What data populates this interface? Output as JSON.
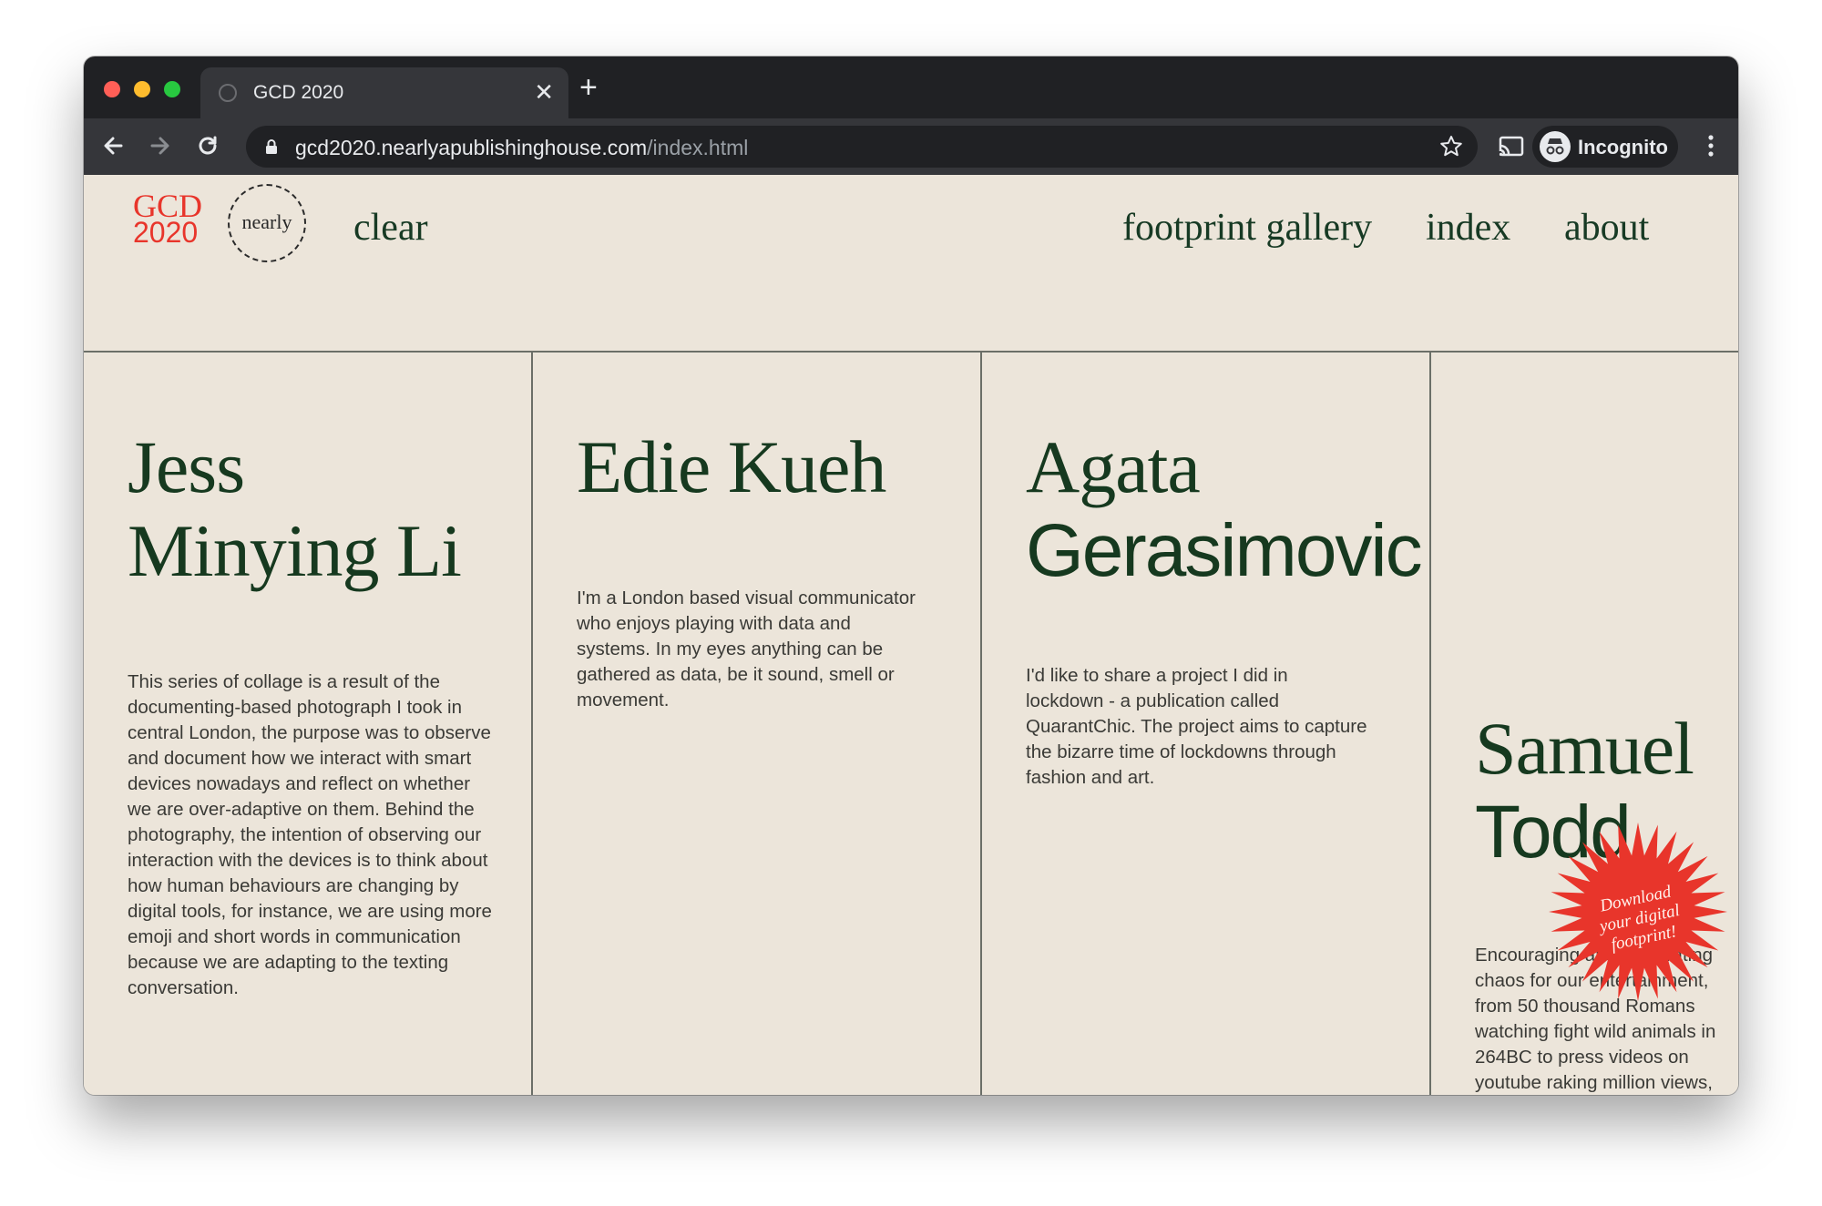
{
  "browser": {
    "tab_title": "GCD 2020",
    "tab_close": "✕",
    "new_tab": "+",
    "url_host": "gcd2020.nearlyapublishinghouse.com",
    "url_path": "/index.html",
    "profile_label": "Incognito"
  },
  "site": {
    "logo_line1": "GCD",
    "logo_line2": "2020",
    "badge_text": "nearly",
    "nav": {
      "clear": "clear",
      "footprint_gallery": "footprint gallery",
      "index": "index",
      "about": "about"
    }
  },
  "contributors": [
    {
      "name_line1": "Jess",
      "name_line2": "Minying Li",
      "bio": "This series of collage is a result of the documenting-based photograph I took in central London, the purpose was to observe and document how we interact with smart devices nowadays and reflect on whether we are over-adaptive on them. Behind the photography, the intention of observing our interaction with the devices is to think about how human behaviours are changing by digital tools, for instance, we are using more emoji and short words in communication because we are adapting to the texting conversation."
    },
    {
      "name_line1": "Edie Kueh",
      "bio": "I'm a London based visual communicator who enjoys playing with data and systems. In my eyes anything can be gathered as data, be it sound, smell or movement."
    },
    {
      "name_line1": "Agata",
      "name_line2": "Gerasimovic",
      "bio": "I'd like to share a project I did in lockdown - a publication called QuarantChic. The project aims to capture the bizarre time of lockdowns through fashion and art."
    },
    {
      "name_line1": "Samuel",
      "name_line2": "Todd",
      "bio": "Encouraging and celebrating chaos for our entertainment, from 50 thousand Romans watching fight wild animals in 264BC to press videos on youtube raking million views, humans have always loved destruction."
    }
  ],
  "starburst": {
    "text": "Download your digital footprint!",
    "color": "#e8352b"
  },
  "colors": {
    "page_bg": "#ece5da",
    "heading": "#16391f",
    "logo_red": "#e8352b",
    "chrome_dark": "#202124"
  }
}
